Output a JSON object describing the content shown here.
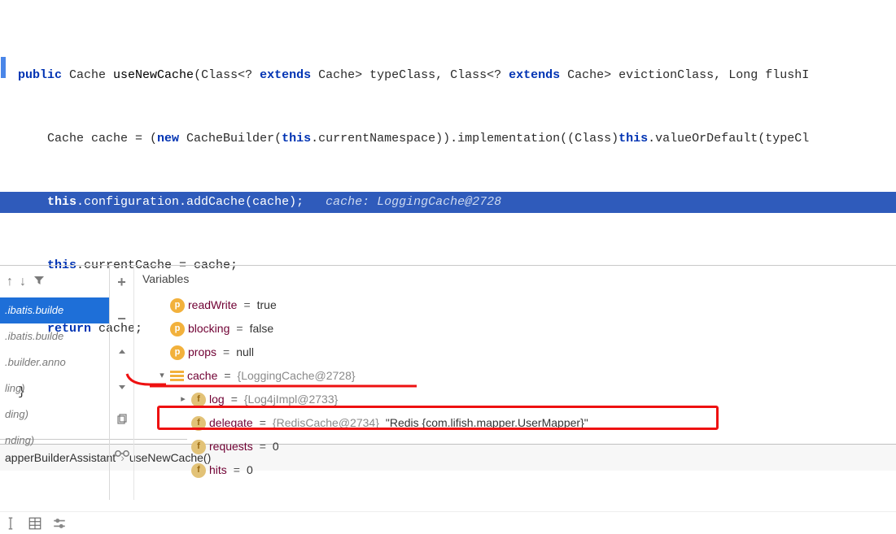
{
  "code": {
    "l1": {
      "kw1": "public",
      "t1": " Cache ",
      "fn": "useNewCache",
      "t2": "(Class<? ",
      "kw2": "extends",
      "t3": " Cache> typeClass, Class<? ",
      "kw3": "extends",
      "t4": " Cache> evictionClass, Long flushI"
    },
    "l2": {
      "t1": "    Cache cache = (",
      "kw1": "new",
      "t2": " CacheBuilder(",
      "kw2": "this",
      "t3": ".currentNamespace)).implementation((Class)",
      "kw3": "this",
      "t4": ".valueOrDefault(typeCl"
    },
    "l3": {
      "sp": "    ",
      "kw1": "this",
      "t1": ".configuration.addCache(cache);",
      "cm": "   cache: LoggingCache@2728"
    },
    "l4": {
      "sp": "    ",
      "kw1": "this",
      "t1": ".currentCache = cache;"
    },
    "l5": {
      "sp": "    ",
      "kw1": "return",
      "t1": " cache;"
    },
    "l6": "}"
  },
  "breadcrumb": {
    "a": "apperBuilderAssistant",
    "sep": "›",
    "b": "useNewCache()"
  },
  "framesToolbar": {
    "up": "↑",
    "down": "↓",
    "filter": "▼"
  },
  "frames": [
    ".ibatis.builde",
    ".ibatis.builde",
    ".builder.anno",
    "ling)",
    "ding)",
    "nding)"
  ],
  "varsHeader": "Variables",
  "vars": {
    "readWrite": {
      "name": "readWrite",
      "val": "true"
    },
    "blocking": {
      "name": "blocking",
      "val": "false"
    },
    "props": {
      "name": "props",
      "val": "null"
    },
    "cache": {
      "name": "cache",
      "val": "{LoggingCache@2728}"
    },
    "log": {
      "name": "log",
      "val": "{Log4jImpl@2733}"
    },
    "delegate": {
      "name": "delegate",
      "val": "{RedisCache@2734}",
      "str": "\"Redis {com.lifish.mapper.UserMapper}\""
    },
    "requests": {
      "name": "requests",
      "val": "0"
    },
    "hits": {
      "name": "hits",
      "val": "0"
    }
  }
}
